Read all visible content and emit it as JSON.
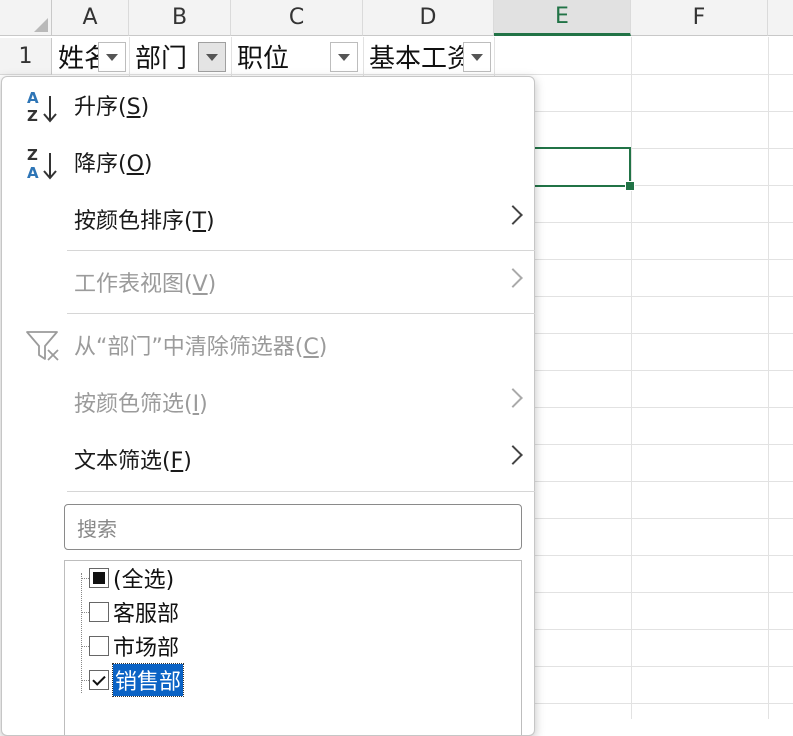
{
  "columns": [
    "A",
    "B",
    "C",
    "D",
    "E",
    "F"
  ],
  "active_column": "E",
  "rows": [
    "1"
  ],
  "cells": {
    "a1": "姓名",
    "b1": "部门",
    "c1": "职位",
    "d1": "基本工资"
  },
  "menu": {
    "sort_asc": {
      "text": "升序(",
      "key": "S",
      "end": ")"
    },
    "sort_desc": {
      "text": "降序(",
      "key": "O",
      "end": ")"
    },
    "sort_by_color": {
      "text": "按颜色排序(",
      "key": "T",
      "end": ")"
    },
    "sheet_view": {
      "text": "工作表视图(",
      "key": "V",
      "end": ")"
    },
    "clear_filter": {
      "text": "从“部门”中清除筛选器(",
      "key": "C",
      "end": ")"
    },
    "filter_by_color": {
      "text": "按颜色筛选(",
      "key": "I",
      "end": ")"
    },
    "text_filter": {
      "text": "文本筛选(",
      "key": "F",
      "end": ")"
    }
  },
  "search": {
    "placeholder": "搜索"
  },
  "filter_list": [
    {
      "label": "(全选)",
      "state": "indeterminate"
    },
    {
      "label": "客服部",
      "state": "unchecked"
    },
    {
      "label": "市场部",
      "state": "unchecked"
    },
    {
      "label": "销售部",
      "state": "checked",
      "highlighted": true
    }
  ],
  "icons": {
    "sort_asc": "sort-ascending-icon",
    "sort_desc": "sort-descending-icon",
    "clear_filter": "clear-filter-icon",
    "submenu": "chevron-right-icon",
    "dropdown": "filter-dropdown-icon"
  },
  "colors": {
    "accent": "#217346",
    "selection": "#0b63c5",
    "sort_icon_blue": "#2e75b6"
  }
}
